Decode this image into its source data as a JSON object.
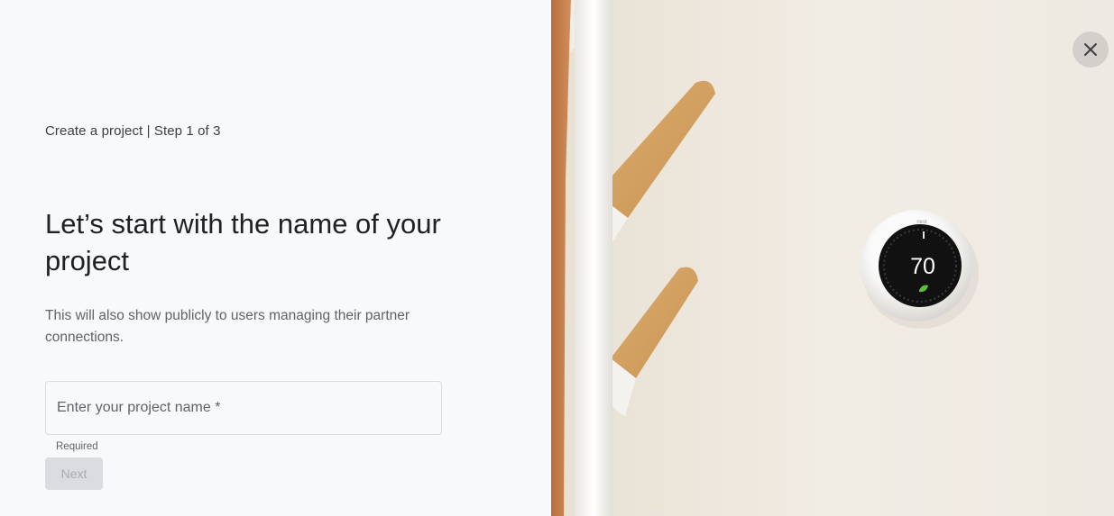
{
  "wizard": {
    "step_label": "Create a project | Step 1 of 3",
    "heading": "Let’s start with the name of your project",
    "description": "This will also show publicly to users managing their partner connections.",
    "project_name_field": {
      "placeholder": "Enter your project name *",
      "value": "",
      "helper_text": "Required"
    },
    "next_label": "Next"
  },
  "hero": {
    "thermostat": {
      "brand": "nest",
      "temperature": "70"
    },
    "close_icon": "close-icon"
  },
  "colors": {
    "panel_background": "#f8f9fa",
    "disabled_button": "#dadce0",
    "disabled_text": "#a8abaf",
    "hero_wall": "#efe9e0"
  }
}
